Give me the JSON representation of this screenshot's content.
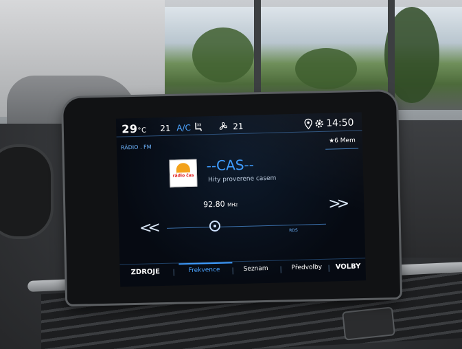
{
  "status": {
    "temp_left": "29",
    "temp_unit": "°C",
    "fan_left": "21",
    "ac_label": "A/C",
    "fan_right": "21",
    "time": "14:50"
  },
  "radio": {
    "source_label": "RÁDIO . FM",
    "presets_label": "6 Mem",
    "station_name": "--CAS--",
    "station_tagline": "Hity proverene casem",
    "logo_text": "rádio čas",
    "frequency": "92.80",
    "frequency_unit": "MHz",
    "rds_label": "RDS",
    "prev_label": "<<",
    "next_label": ">>"
  },
  "tabs": [
    {
      "label": "ZDROJE"
    },
    {
      "label": "Frekvence"
    },
    {
      "label": "Seznam"
    },
    {
      "label": "Předvolby"
    },
    {
      "label": "VOLBY"
    }
  ],
  "colors": {
    "accent": "#3e9cff",
    "text": "#ffffff",
    "screen_bg": "#060a12"
  },
  "icons": {
    "ac": "ac-icon",
    "seat": "seat-heating-icon",
    "fan": "fan-icon",
    "location": "location-icon",
    "settings": "gear-icon",
    "star": "star-icon"
  }
}
